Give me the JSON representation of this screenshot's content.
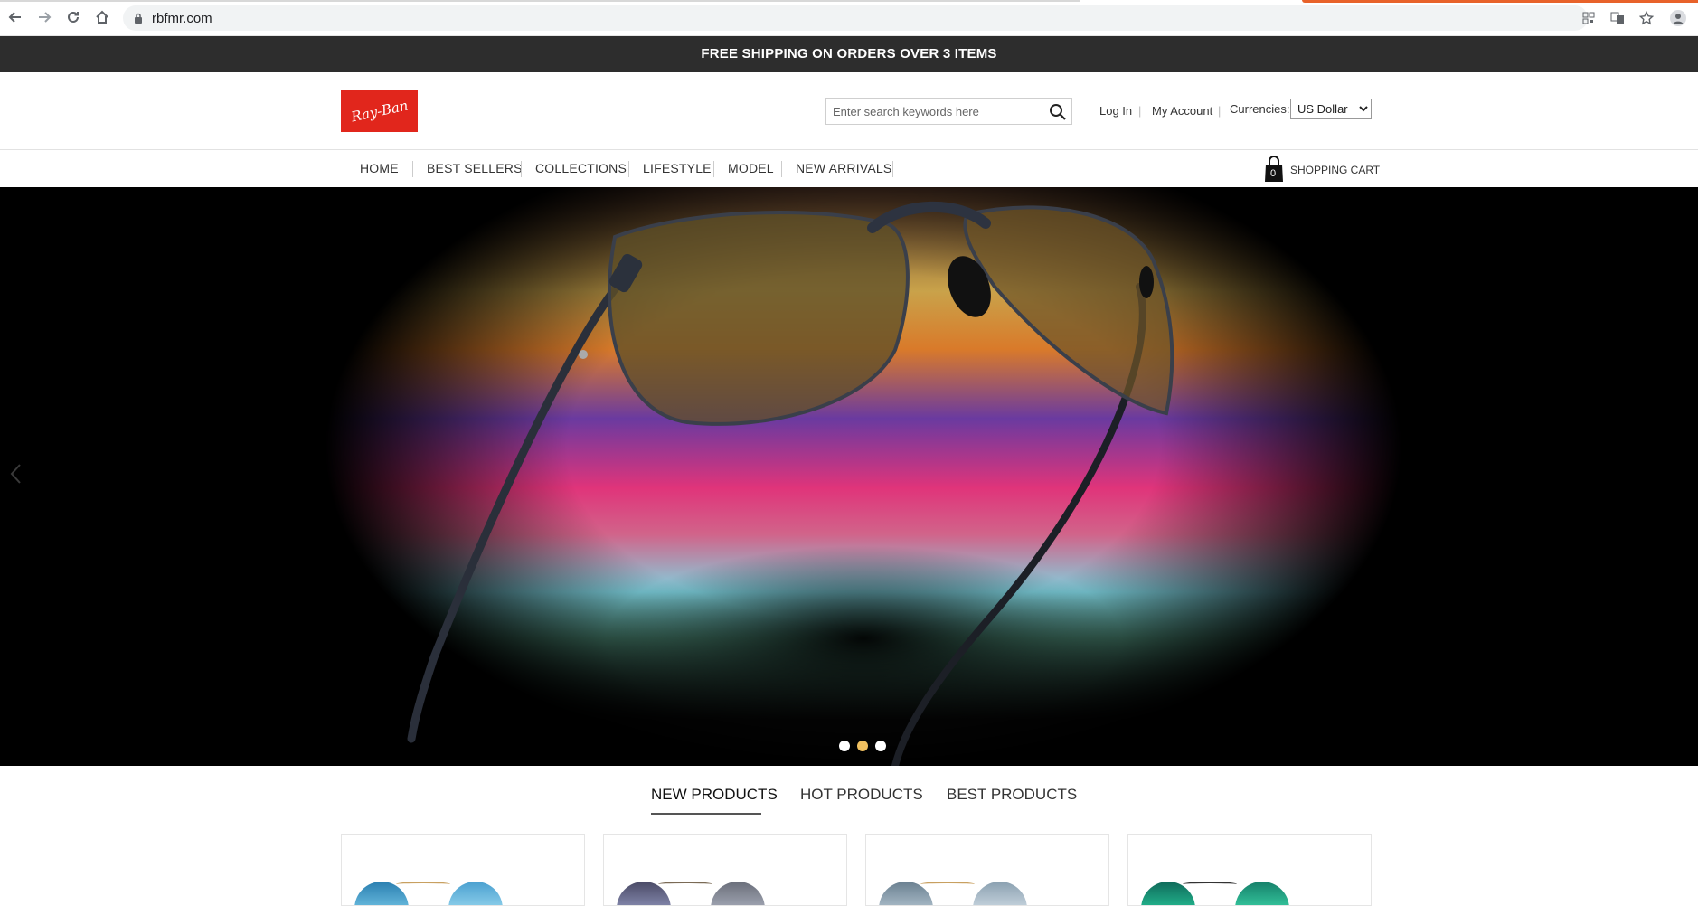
{
  "browser": {
    "url": "rbfmr.com",
    "icons": [
      "back-icon",
      "forward-icon",
      "reload-icon",
      "home-icon",
      "lock-icon",
      "qr-icon",
      "translate-icon",
      "star-icon",
      "profile-icon"
    ]
  },
  "promo": {
    "text": "FREE SHIPPING ON ORDERS OVER 3 ITEMS"
  },
  "header": {
    "logo_text": "Ray-Ban",
    "search_placeholder": "Enter search keywords here",
    "login": "Log In",
    "account": "My Account",
    "currencies_label": "Currencies:",
    "currency_selected": "US Dollar",
    "separator": "|"
  },
  "nav": {
    "items": [
      "HOME",
      "BEST SELLERS",
      "COLLECTIONS",
      "LIFESTYLE",
      "MODEL",
      "NEW ARRIVALS"
    ],
    "cart_count": "0",
    "cart_label": "SHOPPING CART"
  },
  "hero": {
    "slides": 3,
    "active_slide": 2
  },
  "tabs": [
    "NEW PRODUCTS",
    "HOT PRODUCTS",
    "BEST PRODUCTS"
  ],
  "colors": {
    "promo_bg": "#2d2d2d",
    "brand_red": "#e1261c",
    "active_dot": "#f0c060"
  }
}
